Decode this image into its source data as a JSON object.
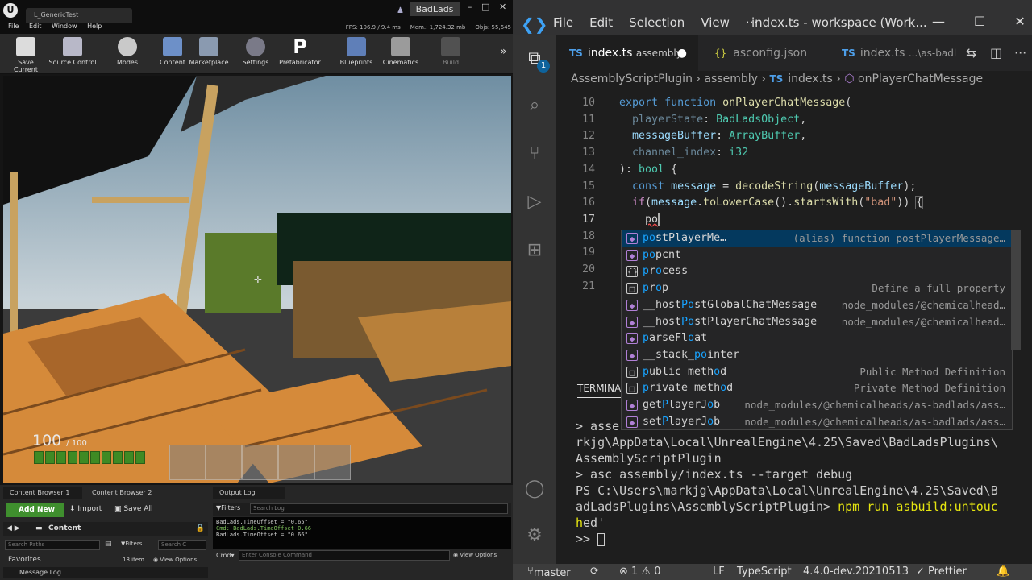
{
  "unreal": {
    "level_tab": "L_GenericTest",
    "app_tab": "BadLads",
    "menu": [
      "File",
      "Edit",
      "Window",
      "Help"
    ],
    "stats": {
      "fps": "FPS: 106.9 / 9.4 ms",
      "mem": "Mem.: 1,724.32 mb",
      "objs": "Objs: 55,645"
    },
    "toolbar": [
      "Save Current",
      "Source Control",
      "Modes",
      "Content",
      "Marketplace",
      "Settings",
      "Prefabricator",
      "Blueprints",
      "Cinematics",
      "Build"
    ],
    "prefab_letter": "P",
    "hud": {
      "health": "100",
      "max_health": "/ 100",
      "health_fraction": 1.0,
      "hotbar_slots": 5
    },
    "panel_tabs": {
      "cb1": "Content Browser 1",
      "cb2": "Content Browser 2",
      "output": "Output Log"
    },
    "content_browser": {
      "add_new": "Add New",
      "import": "Import",
      "save_all": "Save All",
      "path": "Content",
      "search_paths": "Search Paths",
      "filters": "Filters",
      "search_c": "Search C",
      "favorites": "Favorites",
      "items": "18 item",
      "view_options": "View Options"
    },
    "output_log": {
      "filters": "Filters",
      "search_placeholder": "Search Log",
      "lines": [
        {
          "text": "BadLads.TimeOffset = \"0.65\"",
          "green": false
        },
        {
          "text": "Cmd: BadLads.TimeOffset 0.66",
          "green": true
        },
        {
          "text": "BadLads.TimeOffset = \"0.66\"",
          "green": false
        }
      ],
      "cmd_label": "Cmd",
      "console_placeholder": "Enter Console Command",
      "view_options": "View Options"
    },
    "message_log": "Message Log"
  },
  "vscode": {
    "menu": [
      "File",
      "Edit",
      "Selection",
      "View",
      "···"
    ],
    "window_title": "index.ts - workspace (Work...",
    "tabs": [
      {
        "icon": "TS",
        "label": "index.ts",
        "desc": "assembly",
        "active": true,
        "dirty": true
      },
      {
        "icon": "{}",
        "label": "asconfig.json",
        "desc": "",
        "active": false,
        "dirty": false
      },
      {
        "icon": "TS",
        "label": "index.ts",
        "desc": "...\\as-badl",
        "active": false,
        "dirty": false
      }
    ],
    "breadcrumb": [
      "AssemblyScriptPlugin",
      "assembly",
      "index.ts",
      "onPlayerChatMessage"
    ],
    "line_numbers": [
      "10",
      "11",
      "12",
      "13",
      "14",
      "15",
      "16",
      "17",
      "18",
      "19",
      "20",
      "21"
    ],
    "code": {
      "l10": {
        "kw1": "export",
        "kw2": "function",
        "fn": "onPlayerChatMessage",
        "p": "("
      },
      "l11": {
        "p": "playerState",
        "c": ":",
        "t": "BadLadsObject",
        "e": ","
      },
      "l12": {
        "p": "messageBuffer",
        "c": ":",
        "t": "ArrayBuffer",
        "e": ","
      },
      "l13": {
        "p": "channel_index",
        "c": ":",
        "t": "i32"
      },
      "l14": {
        "a": "):",
        "t": "bool",
        "b": "{"
      },
      "l15": {
        "k": "const",
        "v": "message",
        "eq": "=",
        "f": "decodeString",
        "a": "(",
        "v2": "messageBuffer",
        "e": ");"
      },
      "l16": {
        "k": "if",
        "a": "(",
        "v": "message",
        "d": ".",
        "f1": "toLowerCase",
        "b": "().",
        "f2": "startsWith",
        "c": "(",
        "s": "\"bad\"",
        "e": "))",
        "br": "{"
      },
      "l17": {
        "typed": "po"
      }
    },
    "suggestions": [
      {
        "pre": "",
        "match": "po",
        "rest": "stPlayerMe…",
        "detail": "(alias) function postPlayerMessage…",
        "icon": "◆"
      },
      {
        "pre": "",
        "match": "po",
        "rest": "pcnt",
        "detail": "",
        "icon": "◆"
      },
      {
        "pre": "",
        "match": "p",
        "rest": "r",
        "match2": "o",
        "rest2": "cess",
        "detail": "",
        "icon": "{}"
      },
      {
        "pre": "",
        "match": "p",
        "rest": "r",
        "match2": "o",
        "rest2": "p",
        "detail": "Define a full property",
        "icon": "□"
      },
      {
        "pre": "__host",
        "match": "Po",
        "rest": "stGlobalChatMessage",
        "detail": "node_modules/@chemicalhead…",
        "icon": "◆"
      },
      {
        "pre": "__host",
        "match": "Po",
        "rest": "stPlayerChatMessage",
        "detail": "node_modules/@chemicalhead…",
        "icon": "◆"
      },
      {
        "pre": "",
        "match": "p",
        "rest": "arseFl",
        "match2": "o",
        "rest2": "at",
        "detail": "",
        "icon": "◆"
      },
      {
        "pre": "__stack_",
        "match": "po",
        "rest": "inter",
        "detail": "",
        "icon": "◆"
      },
      {
        "pre": "",
        "match": "p",
        "rest": "ublic meth",
        "match2": "o",
        "rest2": "d",
        "detail": "Public Method Definition",
        "icon": "□"
      },
      {
        "pre": "",
        "match": "p",
        "rest": "rivate meth",
        "match2": "o",
        "rest2": "d",
        "detail": "Private Method Definition",
        "icon": "□"
      },
      {
        "pre": "get",
        "match": "P",
        "rest": "layerJ",
        "match2": "o",
        "rest2": "b",
        "detail": "node_modules/@chemicalheads/as-badlads/ass…",
        "icon": "◆"
      },
      {
        "pre": "set",
        "match": "P",
        "rest": "layerJ",
        "match2": "o",
        "rest2": "b",
        "detail": "node_modules/@chemicalheads/as-badlads/ass…",
        "icon": "◆"
      }
    ],
    "panel_tab": "TERMINA",
    "terminal": [
      "> asse",
      "rkjg\\AppData\\Local\\UnrealEngine\\4.25\\Saved\\BadLadsPlugins\\",
      "AssemblyScriptPlugin",
      "> asc assembly/index.ts --target debug",
      "",
      "PS C:\\Users\\markjg\\AppData\\Local\\UnrealEngine\\4.25\\Saved\\B",
      "adLadsPlugins\\AssemblyScriptPlugin> ",
      "ed'",
      ">> "
    ],
    "terminal_cmd": "npm run asbuild:untouc",
    "terminal_cmd2": "h",
    "status": {
      "branch": "master",
      "sync": "⟳",
      "problems": "⊗ 1 ⚠ 0",
      "eol": "LF",
      "lang": "TypeScript",
      "version": "4.4.0-dev.20210513",
      "prettier": "✓ Prettier",
      "bell": "🔔"
    },
    "activity_badge": "1"
  }
}
